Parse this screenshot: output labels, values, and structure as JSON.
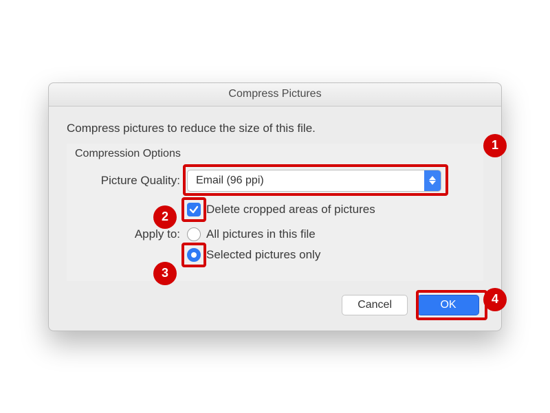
{
  "title": "Compress Pictures",
  "description": "Compress pictures to reduce the size of this file.",
  "group": {
    "title": "Compression Options",
    "quality_label": "Picture Quality:",
    "quality_value": "Email (96 ppi)",
    "delete_cropped_label": "Delete cropped areas of pictures",
    "apply_to_label": "Apply to:",
    "apply_all_label": "All pictures in this file",
    "apply_selected_label": "Selected pictures only"
  },
  "buttons": {
    "cancel": "Cancel",
    "ok": "OK"
  },
  "annotations": {
    "b1": "1",
    "b2": "2",
    "b3": "3",
    "b4": "4"
  }
}
